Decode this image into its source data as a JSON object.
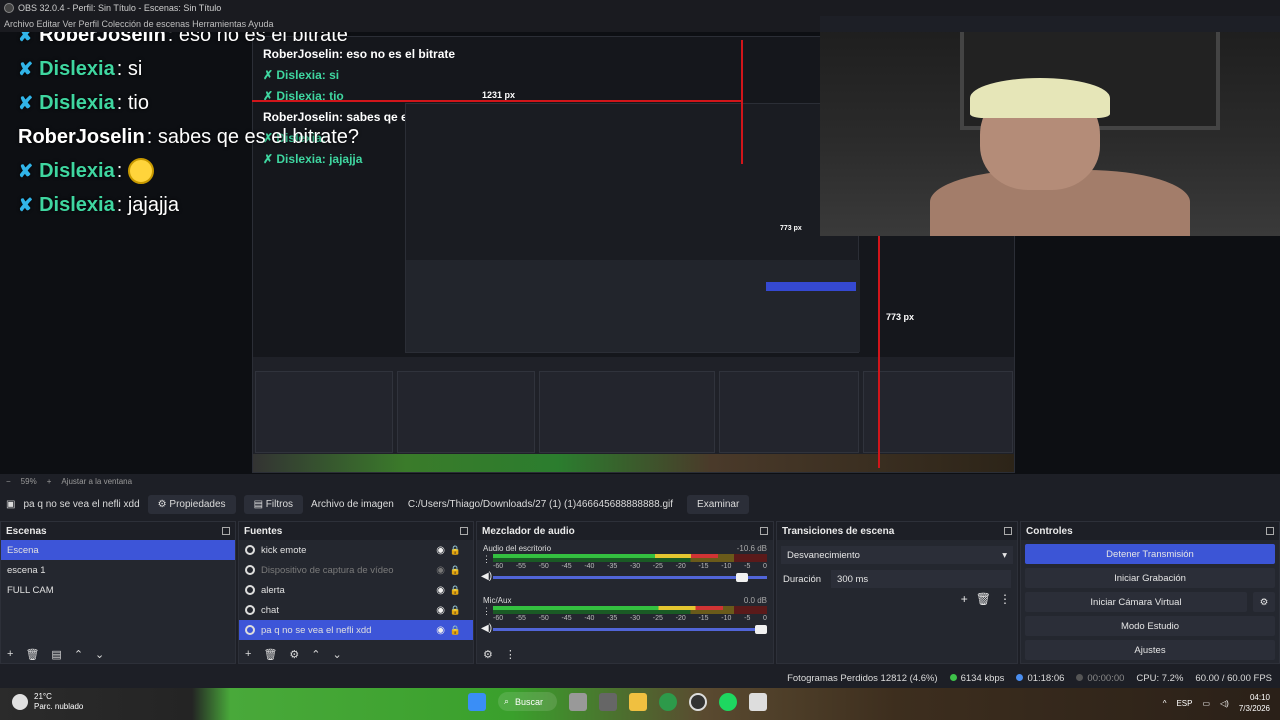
{
  "window": {
    "title": "OBS 32.0.4 - Perfil: Sin Título - Escenas: Sin Título",
    "menu_partial": "Archivo  Editar  Ver  Perfil  Colección de escenas  Herramientas  Ayuda"
  },
  "preview": {
    "chat": [
      {
        "badge": true,
        "name": "RoberJoselin",
        "message": ": eso no es el bitrate",
        "name_color": "#ffffff",
        "emote": false
      },
      {
        "badge": true,
        "name": "Dislexia",
        "message": ": si",
        "name_color": "#3fd6a0",
        "emote": false
      },
      {
        "badge": true,
        "name": "Dislexia",
        "message": ": tio",
        "name_color": "#3fd6a0",
        "emote": false
      },
      {
        "badge": false,
        "name": "RoberJoselin",
        "message": ": sabes qe es el bitrate?",
        "name_color": "#ffffff",
        "emote": false
      },
      {
        "badge": true,
        "name": "Dislexia",
        "message": ":",
        "name_color": "#3fd6a0",
        "emote": true
      },
      {
        "badge": true,
        "name": "Dislexia",
        "message": ": jajajja",
        "name_color": "#3fd6a0",
        "emote": false
      }
    ],
    "nested_chat": [
      "RoberJoselin: eso no es el bitrate",
      "✗ Dislexia: si",
      "✗ Dislexia: tio",
      "RoberJoselin: sabes qe es el bitrate?",
      "✗ Dislexia:",
      "✗ Dislexia: jajajja"
    ],
    "measure_1": "1231 px",
    "measure_2": "773 px",
    "measure_3": "773 px"
  },
  "zoom": {
    "level": "59%",
    "fit_label": "Ajustar a la ventana"
  },
  "source_toolbar": {
    "source_name": "pa q no se vea el nefli xdd",
    "properties": "Propiedades",
    "filters": "Filtros",
    "image_label": "Archivo de imagen",
    "path": "C:/Users/Thiago/Downloads/27 (1) (1)466645688888888.gif",
    "browse": "Examinar"
  },
  "scenes": {
    "title": "Escenas",
    "items": [
      "Escena",
      "escena 1",
      "FULL CAM"
    ],
    "selected_index": 0
  },
  "sources": {
    "title": "Fuentes",
    "items": [
      {
        "label": "kick emote",
        "dim": false,
        "selected": false,
        "visible": true
      },
      {
        "label": "Dispositivo de captura de vídeo",
        "dim": true,
        "selected": false,
        "visible": false
      },
      {
        "label": "alerta",
        "dim": false,
        "selected": false,
        "visible": true
      },
      {
        "label": "chat",
        "dim": false,
        "selected": false,
        "visible": true
      },
      {
        "label": "pa q no se vea el nefli xdd",
        "dim": false,
        "selected": true,
        "visible": true
      }
    ]
  },
  "mixer": {
    "title": "Mezclador de audio",
    "ticks": [
      "-60",
      "-55",
      "-50",
      "-45",
      "-40",
      "-35",
      "-30",
      "-25",
      "-20",
      "-15",
      "-10",
      "-5",
      "0"
    ],
    "channels": [
      {
        "name": "Audio del escritorio",
        "db": "-10.6 dB",
        "level": 0.82,
        "volume": 0.93
      },
      {
        "name": "Mic/Aux",
        "db": "0.0 dB",
        "level": 0.84,
        "volume": 1.0
      }
    ]
  },
  "transitions": {
    "title": "Transiciones de escena",
    "selected": "Desvanecimiento",
    "duration_label": "Duración",
    "duration_value": "300 ms"
  },
  "controls": {
    "title": "Controles",
    "buttons": [
      "Detener Transmisión",
      "Iniciar Grabación",
      "Iniciar Cámara Virtual",
      "Modo Estudio",
      "Ajustes"
    ]
  },
  "status": {
    "dropped_frames": "Fotogramas Perdidos 12812 (4.6%)",
    "bitrate": "6134 kbps",
    "stream_time": "01:18:06",
    "rec_time": "00:00:00",
    "cpu": "CPU: 7.2%",
    "fps": "60.00 / 60.00 FPS"
  },
  "taskbar": {
    "temperature": "21°C",
    "weather": "Parc. nublado",
    "search": "Buscar",
    "language": "ESP",
    "time": "04:10",
    "date": "7/3/2026"
  },
  "colors": {
    "accent": "#3d55d8",
    "chat_badge": "#31b4e8",
    "red_guide": "#d1151a"
  }
}
